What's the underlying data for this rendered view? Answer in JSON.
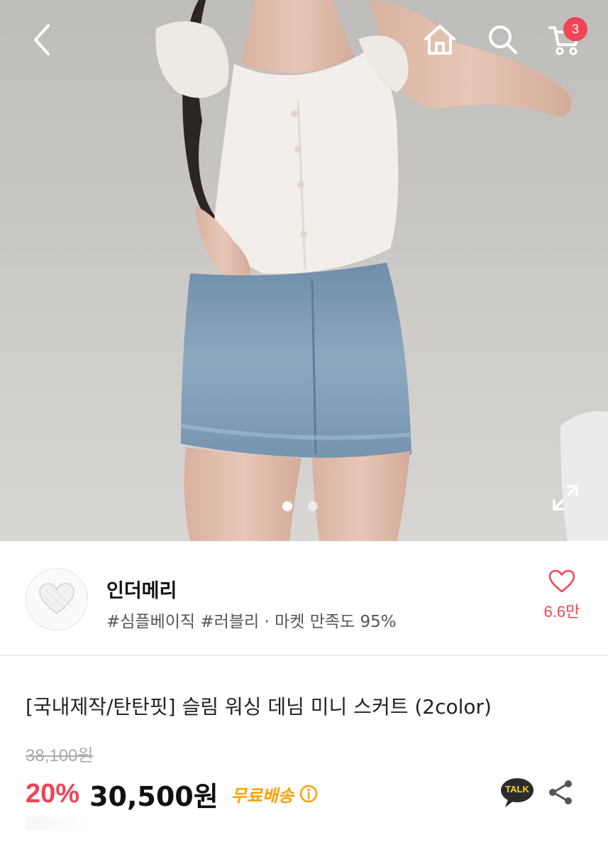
{
  "header": {
    "back_icon": "chevron-left-icon",
    "home_icon": "home-icon",
    "search_icon": "search-icon",
    "cart_icon": "cart-icon",
    "cart_count": "3"
  },
  "gallery": {
    "image_count": 2,
    "active_index": 0,
    "expand_icon": "expand-icon"
  },
  "shop": {
    "name": "인더메리",
    "tags": "#심플베이직 #러블리 · 마켓 만족도 95%",
    "like_count": "6.6만",
    "like_icon": "heart-outline-icon"
  },
  "product": {
    "title": "[국내제작/탄탄핏] 슬림 워싱 데님 미니 스커트 (2color)",
    "original_price": "38,100원",
    "discount": "20%",
    "sale_price": "30,500원",
    "shipping": "무료배송",
    "talk_label": "TALK"
  },
  "colors": {
    "accent": "#f04457",
    "shipping": "#f5a300",
    "talk_bubble": "#2b2b2b",
    "talk_text": "#f7d900"
  }
}
